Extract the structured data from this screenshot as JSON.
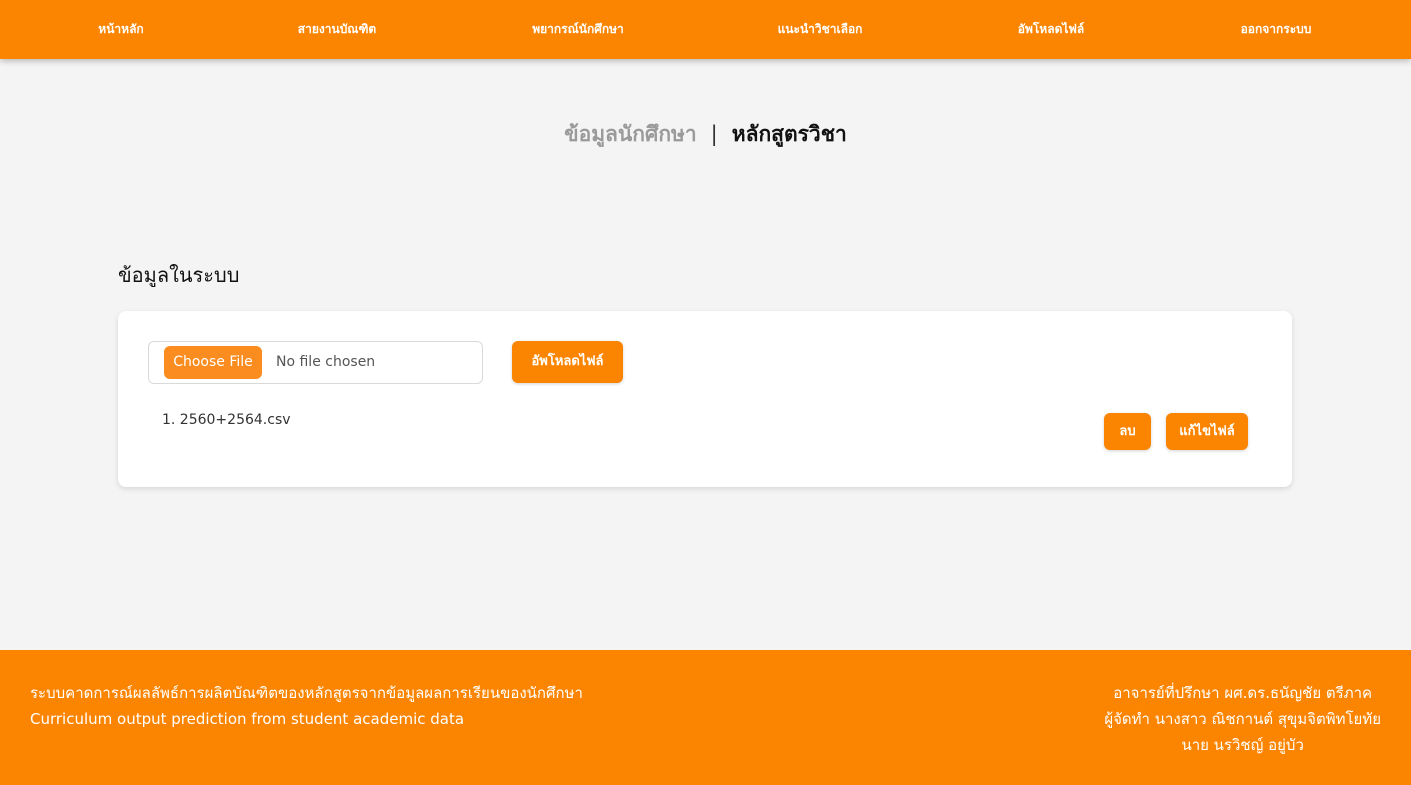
{
  "nav": {
    "items": [
      {
        "label": "หน้าหลัก"
      },
      {
        "label": "สายงานบัณฑิต"
      },
      {
        "label": "พยากรณ์นักศึกษา"
      },
      {
        "label": "แนะนำวิชาเลือก"
      },
      {
        "label": "อัพโหลดไฟล์"
      },
      {
        "label": "ออกจากระบบ"
      }
    ]
  },
  "view_switch": {
    "inactive_label": "ข้อมูลนักศึกษา",
    "separator": "|",
    "active_label": "หลักสูตรวิชา"
  },
  "section": {
    "title": "ข้อมูลในระบบ"
  },
  "upload": {
    "choose_label": "Choose File",
    "no_file_text": "No file chosen",
    "upload_button": "อัพโหลดไฟล์"
  },
  "files": [
    {
      "name": "1. 2560+2564.csv",
      "delete_label": "ลบ",
      "edit_label": "แก้ไขไฟล์"
    }
  ],
  "footer": {
    "title_th": "ระบบคาดการณ์ผลลัพธ์การผลิตบัณฑิตของหลักสูตรจากข้อมูลผลการเรียนของนักศึกษา",
    "title_en": "Curriculum output prediction from student academic data",
    "advisor": "อาจารย์ที่ปรึกษา ผศ.ดร.ธนัญชัย ตรีภาค",
    "author1": "ผู้จัดทำ นางสาว ณิชกานต์ สุขุมจิตพิทโยทัย",
    "author2": "นาย นรวิชญ์ อยู่บัว"
  },
  "colors": {
    "accent": "#fb8500",
    "background": "#f4f4f4"
  }
}
